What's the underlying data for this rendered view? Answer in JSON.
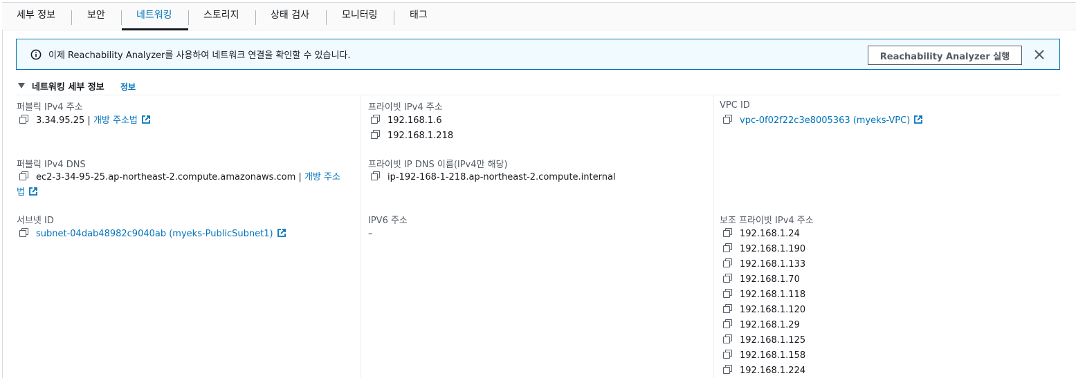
{
  "tabs": [
    {
      "label": "세부 정보"
    },
    {
      "label": "보안"
    },
    {
      "label": "네트워킹"
    },
    {
      "label": "스토리지"
    },
    {
      "label": "상태 검사"
    },
    {
      "label": "모니터링"
    },
    {
      "label": "태그"
    }
  ],
  "active_tab": "네트워킹",
  "flash": {
    "message": "이제 Reachability Analyzer를 사용하여 네트워크 연결을 확인할 수 있습니다.",
    "button_label": "Reachability Analyzer 실행",
    "icon": "info-icon",
    "close_icon": "close-icon"
  },
  "section": {
    "title": "네트워킹 세부 정보",
    "info_link": "정보"
  },
  "col1": {
    "public_ipv4": {
      "label": "퍼블릭 IPv4 주소",
      "value": "3.34.95.25",
      "separator": " | ",
      "link": "개방 주소법"
    },
    "public_dns": {
      "label": "퍼블릭 IPv4 DNS",
      "value": "ec2-3-34-95-25.ap-northeast-2.compute.amazonaws.com",
      "separator": " | ",
      "link_part1": "개방 주소",
      "link_part2": "법"
    },
    "subnet": {
      "label": "서브넷 ID",
      "value": "subnet-04dab48982c9040ab (myeks-PublicSubnet1)"
    }
  },
  "col2": {
    "private_ipv4": {
      "label": "프라이빗 IPv4 주소",
      "values": [
        "192.168.1.6",
        "192.168.1.218"
      ]
    },
    "private_dns": {
      "label": "프라이빗 IP DNS 이름(IPv4만 해당)",
      "value": "ip-192-168-1-218.ap-northeast-2.compute.internal"
    },
    "ipv6": {
      "label": "IPV6 주소",
      "value": "–"
    }
  },
  "col3": {
    "vpc": {
      "label": "VPC ID",
      "value": "vpc-0f02f22c3e8005363 (myeks-VPC)"
    },
    "secondary_ipv4": {
      "label": "보조 프라이빗 IPv4 주소",
      "values": [
        "192.168.1.24",
        "192.168.1.190",
        "192.168.1.133",
        "192.168.1.70",
        "192.168.1.118",
        "192.168.1.120",
        "192.168.1.29",
        "192.168.1.125",
        "192.168.1.158",
        "192.168.1.224"
      ]
    }
  },
  "colors": {
    "link": "#0073bb",
    "flash_bg": "#f1faff",
    "flash_border": "#0073bb",
    "text": "#16191f",
    "label": "#545b64"
  }
}
